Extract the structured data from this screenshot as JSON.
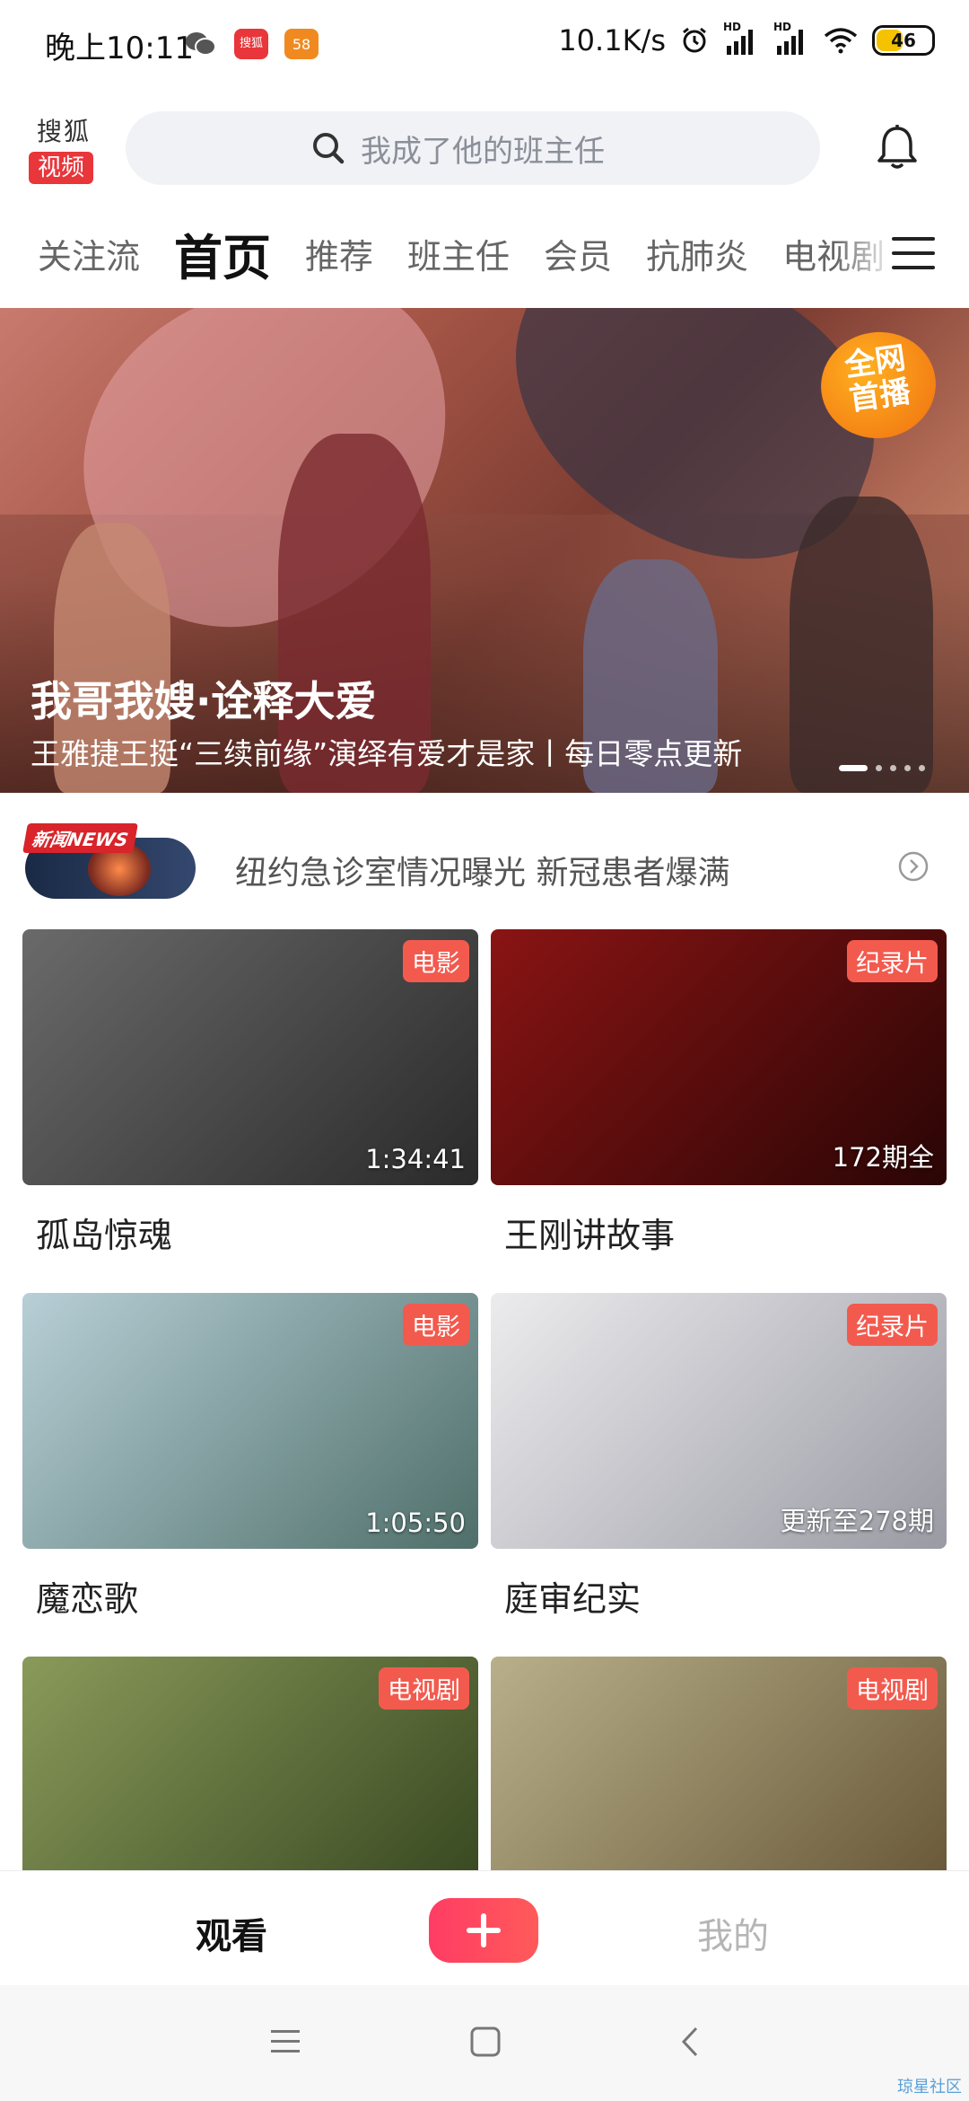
{
  "status_bar": {
    "time": "晚上10:11",
    "network_speed": "10.1K/s",
    "signal_label_1": "HD",
    "signal_label_2": "HD",
    "battery": "46",
    "app_icon_1": "搜狐",
    "app_icon_2": "58"
  },
  "header": {
    "logo_top": "搜狐",
    "logo_bottom": "视频",
    "search_placeholder": "我成了他的班主任"
  },
  "tabs": [
    {
      "label": "关注流",
      "active": false
    },
    {
      "label": "首页",
      "active": true
    },
    {
      "label": "推荐",
      "active": false
    },
    {
      "label": "班主任",
      "active": false
    },
    {
      "label": "会员",
      "active": false
    },
    {
      "label": "抗肺炎",
      "active": false
    },
    {
      "label": "电视剧",
      "active": false
    }
  ],
  "banner": {
    "badge_line1": "全网",
    "badge_line2": "首播",
    "title": "我哥我嫂·诠释大爱",
    "subtitle": "王雅捷王挺“三续前缘”演绎有爱才是家丨每日零点更新",
    "dot_count": 6,
    "active_dot": 0
  },
  "news": {
    "tag": "新闻NEWS",
    "headline": "纽约急诊室情况曝光 新冠患者爆满"
  },
  "cards": [
    {
      "tag": "电影",
      "meta": "1:34:41",
      "title": "孤岛惊魂",
      "colors": [
        "#5b5b5b",
        "#2a2a2a"
      ]
    },
    {
      "tag": "纪录片",
      "meta": "172期全",
      "title": "王刚讲故事",
      "colors": [
        "#8a1414",
        "#2a0505"
      ]
    },
    {
      "tag": "电影",
      "meta": "1:05:50",
      "title": "魔恋歌",
      "colors": [
        "#9fbcc4",
        "#4f6f6a"
      ]
    },
    {
      "tag": "纪录片",
      "meta": "更新至278期",
      "title": "庭审纪实",
      "colors": [
        "#e8e8ea",
        "#9a9aa4"
      ]
    },
    {
      "tag": "电视剧",
      "meta": "",
      "title": "",
      "colors": [
        "#7a8a4a",
        "#3a4a22"
      ]
    },
    {
      "tag": "电视剧",
      "meta": "",
      "title": "",
      "colors": [
        "#a8a080",
        "#6a5a3a"
      ]
    }
  ],
  "bottom_nav": {
    "watch": "观看",
    "mine": "我的"
  },
  "watermark": "琼星社区"
}
